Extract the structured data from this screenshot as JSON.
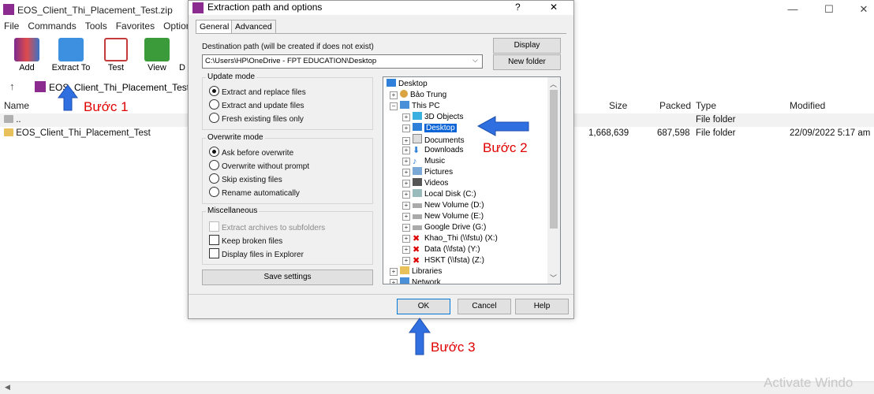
{
  "main": {
    "title": "EOS_Client_Thi_Placement_Test.zip",
    "menu": [
      "File",
      "Commands",
      "Tools",
      "Favorites",
      "Options"
    ],
    "toolbar": [
      "Add",
      "Extract To",
      "Test",
      "View",
      "D"
    ],
    "address": "EOS_Client_Thi_Placement_Test.zip",
    "columns": {
      "name": "Name",
      "size": "Size",
      "packed": "Packed",
      "type": "Type",
      "modified": "Modified"
    },
    "rows": [
      {
        "name": "..",
        "size": "",
        "packed": "",
        "type": "File folder",
        "modified": ""
      },
      {
        "name": "EOS_Client_Thi_Placement_Test",
        "size": "1,668,639",
        "packed": "687,598",
        "type": "File folder",
        "modified": "22/09/2022 5:17 am"
      }
    ],
    "activate": "Activate Windo"
  },
  "dialog": {
    "title": "Extraction path and options",
    "help_glyph": "?",
    "close_glyph": "✕",
    "tabs": [
      "General",
      "Advanced"
    ],
    "dest_label": "Destination path (will be created if does not exist)",
    "dest_value": "C:\\Users\\HP\\OneDrive - FPT EDUCATION\\Desktop",
    "display_btn": "Display",
    "newfolder_btn": "New folder",
    "update_mode": {
      "title": "Update mode",
      "options": [
        "Extract and replace files",
        "Extract and update files",
        "Fresh existing files only"
      ]
    },
    "overwrite_mode": {
      "title": "Overwrite mode",
      "options": [
        "Ask before overwrite",
        "Overwrite without prompt",
        "Skip existing files",
        "Rename automatically"
      ]
    },
    "misc": {
      "title": "Miscellaneous",
      "options": [
        "Extract archives to subfolders",
        "Keep broken files",
        "Display files in Explorer"
      ]
    },
    "save_btn": "Save settings",
    "tree": [
      "Desktop",
      "Bảo Trung",
      "This PC",
      "3D Objects",
      "Desktop",
      "Documents",
      "Downloads",
      "Music",
      "Pictures",
      "Videos",
      "Local Disk (C:)",
      "New Volume (D:)",
      "New Volume (E:)",
      "Google Drive (G:)",
      "Khao_Thi (\\\\fstu) (X:)",
      "Data (\\\\fsta) (Y:)",
      "HSKT (\\\\fsta) (Z:)",
      "Libraries",
      "Network"
    ],
    "ok_btn": "OK",
    "cancel_btn": "Cancel",
    "help_btn": "Help"
  },
  "annotations": {
    "step1": "Bước 1",
    "step2": "Bước 2",
    "step3": "Bước 3"
  },
  "colors": {
    "arrow": "#2f6fe0",
    "annotation_text": "#e00000",
    "selection": "#0a64d6"
  }
}
